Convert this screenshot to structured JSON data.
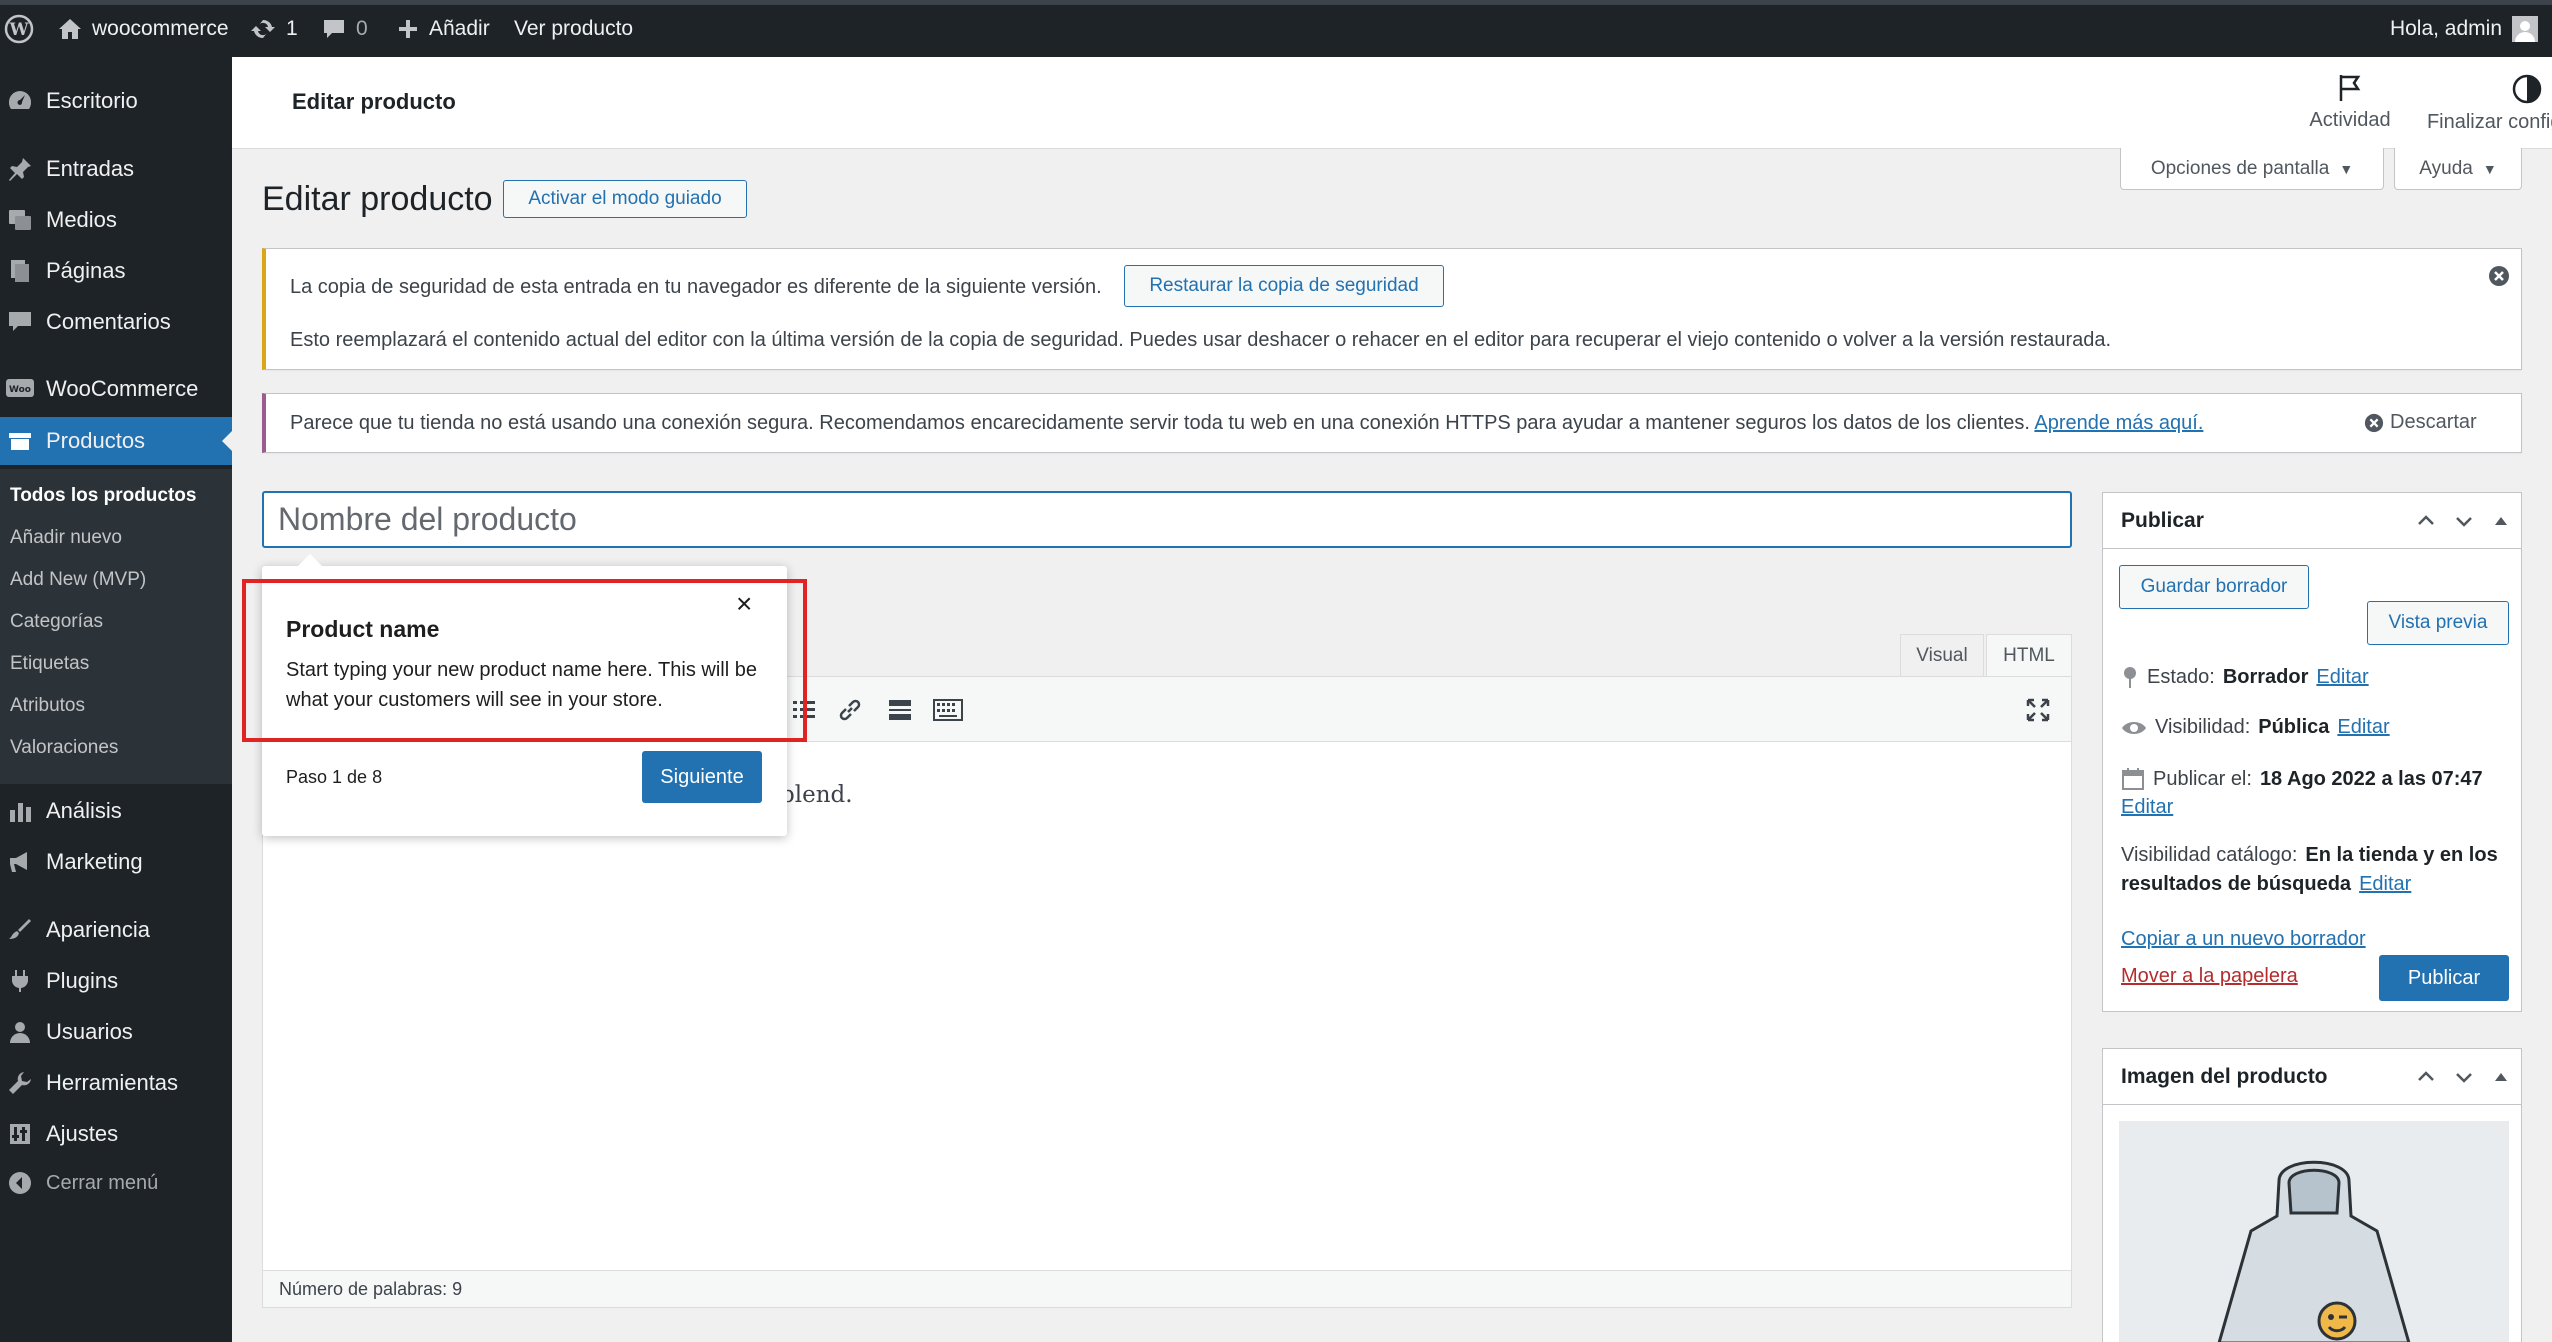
{
  "admin_bar": {
    "site_name": "woocommerce",
    "updates_count": "1",
    "comments_count": "0",
    "new_label": "Añadir",
    "view_label": "Ver producto",
    "greeting": "Hola, admin"
  },
  "sidebar": {
    "items": [
      {
        "label": "Escritorio",
        "icon": "dashboard-icon"
      },
      {
        "label": "Entradas",
        "icon": "pin-icon"
      },
      {
        "label": "Medios",
        "icon": "media-icon"
      },
      {
        "label": "Páginas",
        "icon": "pages-icon"
      },
      {
        "label": "Comentarios",
        "icon": "comment-icon"
      },
      {
        "label": "WooCommerce",
        "icon": "woo-icon"
      },
      {
        "label": "Productos",
        "icon": "products-icon"
      },
      {
        "label": "Análisis",
        "icon": "chart-icon"
      },
      {
        "label": "Marketing",
        "icon": "megaphone-icon"
      },
      {
        "label": "Apariencia",
        "icon": "brush-icon"
      },
      {
        "label": "Plugins",
        "icon": "plugin-icon"
      },
      {
        "label": "Usuarios",
        "icon": "user-icon"
      },
      {
        "label": "Herramientas",
        "icon": "wrench-icon"
      },
      {
        "label": "Ajustes",
        "icon": "settings-icon"
      },
      {
        "label": "Cerrar menú",
        "icon": "collapse-icon"
      }
    ],
    "submenu": [
      "Todos los productos",
      "Añadir nuevo",
      "Add New (MVP)",
      "Categorías",
      "Etiquetas",
      "Atributos",
      "Valoraciones"
    ]
  },
  "header": {
    "title": "Editar producto",
    "activity_label": "Actividad",
    "finish_label": "Finalizar configuración",
    "screen_options": "Opciones de pantalla",
    "help": "Ayuda"
  },
  "page": {
    "title": "Editar producto",
    "guided_button": "Activar el modo guiado"
  },
  "notices": {
    "backup_text": "La copia de seguridad de esta entrada en tu navegador es diferente de la siguiente versión.",
    "backup_button": "Restaurar la copia de seguridad",
    "backup_detail": "Esto reemplazará el contenido actual del editor con la última versión de la copia de seguridad. Puedes usar deshacer o rehacer en el editor para recuperar el viejo contenido o volver a la versión restaurada.",
    "https_text": "Parece que tu tienda no está usando una conexión segura. Recomendamos encarecidamente servir toda tu web en una conexión HTTPS para ayudar a mantener seguros los datos de los clientes.",
    "https_link": "Aprende más aquí.",
    "dismiss": "Descartar"
  },
  "editor": {
    "title_placeholder": "Nombre del producto",
    "tab_visual": "Visual",
    "tab_html": "HTML",
    "content_fragment": "blend.",
    "word_count": "Número de palabras: 9"
  },
  "publish_box": {
    "title": "Publicar",
    "save_draft": "Guardar borrador",
    "preview": "Vista previa",
    "status_label": "Estado:",
    "status_value": "Borrador",
    "visibility_label": "Visibilidad:",
    "visibility_value": "Pública",
    "publish_label": "Publicar el:",
    "publish_value": "18 Ago 2022 a las 07:47",
    "edit": "Editar",
    "catalog_label": "Visibilidad catálogo:",
    "catalog_value_1": "En la tienda y en los",
    "catalog_value_2": "resultados de búsqueda",
    "copy_draft": "Copiar a un nuevo borrador",
    "trash": "Mover a la papelera",
    "publish_button": "Publicar"
  },
  "image_box": {
    "title": "Imagen del producto"
  },
  "tour": {
    "title": "Product name",
    "body": "Start typing your new product name here. This will be what your customers will see in your store.",
    "step": "Paso 1 de 8",
    "next": "Siguiente",
    "close": "×"
  },
  "colors": {
    "admin_dark": "#1d2327",
    "accent": "#2271b1",
    "highlight": "#e02424"
  }
}
